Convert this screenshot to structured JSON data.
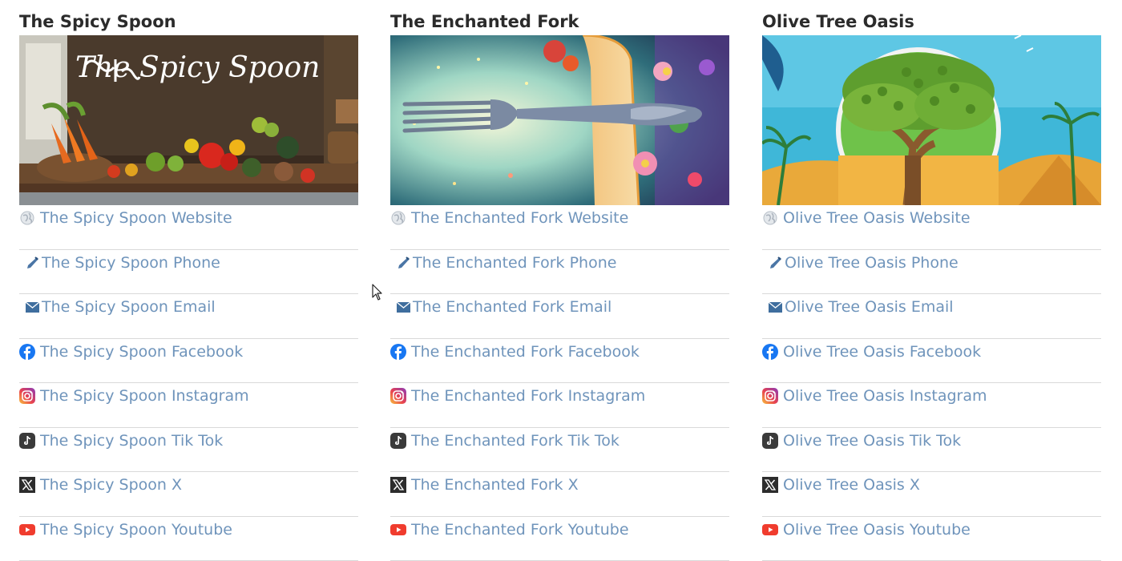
{
  "restaurants": [
    {
      "title": "The Spicy Spoon",
      "banner_text": "The Spicy Spoon",
      "links": [
        {
          "icon": "globe-icon",
          "label": "The Spicy Spoon Website"
        },
        {
          "icon": "phone-icon",
          "label": "The Spicy Spoon Phone"
        },
        {
          "icon": "email-icon",
          "label": "The Spicy Spoon Email"
        },
        {
          "icon": "facebook-icon",
          "label": "The Spicy Spoon Facebook"
        },
        {
          "icon": "instagram-icon",
          "label": "The Spicy Spoon Instagram"
        },
        {
          "icon": "tiktok-icon",
          "label": "The Spicy Spoon Tik Tok"
        },
        {
          "icon": "x-icon",
          "label": "The Spicy Spoon X"
        },
        {
          "icon": "youtube-icon",
          "label": "The Spicy Spoon Youtube"
        }
      ]
    },
    {
      "title": "The Enchanted Fork",
      "links": [
        {
          "icon": "globe-icon",
          "label": "The Enchanted Fork Website"
        },
        {
          "icon": "phone-icon",
          "label": "The Enchanted Fork Phone"
        },
        {
          "icon": "email-icon",
          "label": "The Enchanted Fork Email"
        },
        {
          "icon": "facebook-icon",
          "label": "The Enchanted Fork Facebook"
        },
        {
          "icon": "instagram-icon",
          "label": "The Enchanted Fork Instagram"
        },
        {
          "icon": "tiktok-icon",
          "label": "The Enchanted Fork Tik Tok"
        },
        {
          "icon": "x-icon",
          "label": "The Enchanted Fork X"
        },
        {
          "icon": "youtube-icon",
          "label": "The Enchanted Fork Youtube"
        }
      ]
    },
    {
      "title": "Olive Tree Oasis",
      "links": [
        {
          "icon": "globe-icon",
          "label": "Olive Tree Oasis Website"
        },
        {
          "icon": "phone-icon",
          "label": "Olive Tree Oasis Phone"
        },
        {
          "icon": "email-icon",
          "label": "Olive Tree Oasis Email"
        },
        {
          "icon": "facebook-icon",
          "label": "Olive Tree Oasis Facebook"
        },
        {
          "icon": "instagram-icon",
          "label": "Olive Tree Oasis Instagram"
        },
        {
          "icon": "tiktok-icon",
          "label": "Olive Tree Oasis Tik Tok"
        },
        {
          "icon": "x-icon",
          "label": "Olive Tree Oasis X"
        },
        {
          "icon": "youtube-icon",
          "label": "Olive Tree Oasis Youtube"
        }
      ]
    }
  ],
  "colors": {
    "link": "#6f94bb",
    "title": "#2b2b2b",
    "divider": "#d9d9d9",
    "facebook": "#1877f2",
    "youtube": "#ff0000"
  }
}
